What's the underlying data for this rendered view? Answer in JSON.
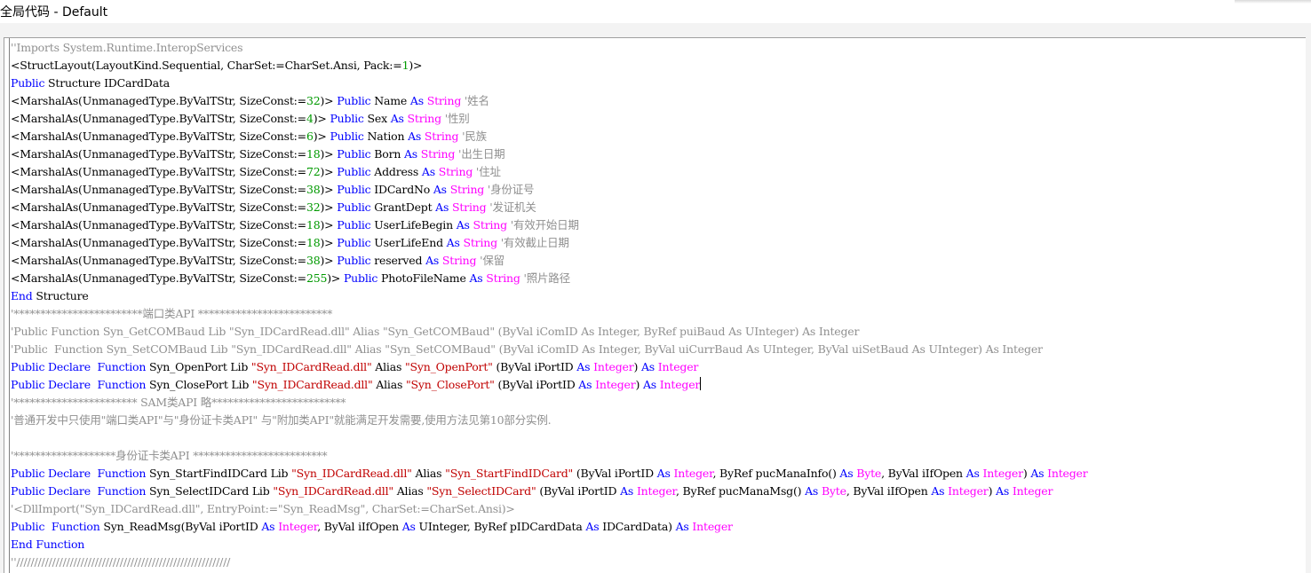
{
  "window": {
    "title": "全局代码 - Default"
  },
  "colors": {
    "keyword": "#0000ff",
    "type": "#ff00ff",
    "string": "#c00000",
    "number": "#009900",
    "comment": "#909090",
    "plain": "#000000"
  },
  "editor": {
    "lines": [
      [
        [
          "c",
          "''Imports System.Runtime.InteropServices"
        ]
      ],
      [
        [
          "p",
          "<StructLayout(LayoutKind.Sequential, CharSet:=CharSet.Ansi, Pack:="
        ],
        [
          "n",
          "1"
        ],
        [
          "p",
          ")>"
        ]
      ],
      [
        [
          "k",
          "Public"
        ],
        [
          "p",
          " Structure IDCardData"
        ]
      ],
      [
        [
          "p",
          "<MarshalAs(UnmanagedType.ByValTStr, SizeConst:="
        ],
        [
          "n",
          "32"
        ],
        [
          "p",
          ")> "
        ],
        [
          "k",
          "Public"
        ],
        [
          "p",
          " Name "
        ],
        [
          "k",
          "As"
        ],
        [
          "p",
          " "
        ],
        [
          "t",
          "String"
        ],
        [
          "p",
          " "
        ],
        [
          "c",
          "'姓名"
        ]
      ],
      [
        [
          "p",
          "<MarshalAs(UnmanagedType.ByValTStr, SizeConst:="
        ],
        [
          "n",
          "4"
        ],
        [
          "p",
          ")> "
        ],
        [
          "k",
          "Public"
        ],
        [
          "p",
          " Sex "
        ],
        [
          "k",
          "As"
        ],
        [
          "p",
          " "
        ],
        [
          "t",
          "String"
        ],
        [
          "p",
          " "
        ],
        [
          "c",
          "'性别"
        ]
      ],
      [
        [
          "p",
          "<MarshalAs(UnmanagedType.ByValTStr, SizeConst:="
        ],
        [
          "n",
          "6"
        ],
        [
          "p",
          ")> "
        ],
        [
          "k",
          "Public"
        ],
        [
          "p",
          " Nation "
        ],
        [
          "k",
          "As"
        ],
        [
          "p",
          " "
        ],
        [
          "t",
          "String"
        ],
        [
          "p",
          " "
        ],
        [
          "c",
          "'民族"
        ]
      ],
      [
        [
          "p",
          "<MarshalAs(UnmanagedType.ByValTStr, SizeConst:="
        ],
        [
          "n",
          "18"
        ],
        [
          "p",
          ")> "
        ],
        [
          "k",
          "Public"
        ],
        [
          "p",
          " Born "
        ],
        [
          "k",
          "As"
        ],
        [
          "p",
          " "
        ],
        [
          "t",
          "String"
        ],
        [
          "p",
          " "
        ],
        [
          "c",
          "'出生日期"
        ]
      ],
      [
        [
          "p",
          "<MarshalAs(UnmanagedType.ByValTStr, SizeConst:="
        ],
        [
          "n",
          "72"
        ],
        [
          "p",
          ")> "
        ],
        [
          "k",
          "Public"
        ],
        [
          "p",
          " Address "
        ],
        [
          "k",
          "As"
        ],
        [
          "p",
          " "
        ],
        [
          "t",
          "String"
        ],
        [
          "p",
          " "
        ],
        [
          "c",
          "'住址"
        ]
      ],
      [
        [
          "p",
          "<MarshalAs(UnmanagedType.ByValTStr, SizeConst:="
        ],
        [
          "n",
          "38"
        ],
        [
          "p",
          ")> "
        ],
        [
          "k",
          "Public"
        ],
        [
          "p",
          " IDCardNo "
        ],
        [
          "k",
          "As"
        ],
        [
          "p",
          " "
        ],
        [
          "t",
          "String"
        ],
        [
          "p",
          " "
        ],
        [
          "c",
          "'身份证号"
        ]
      ],
      [
        [
          "p",
          "<MarshalAs(UnmanagedType.ByValTStr, SizeConst:="
        ],
        [
          "n",
          "32"
        ],
        [
          "p",
          ")> "
        ],
        [
          "k",
          "Public"
        ],
        [
          "p",
          " GrantDept "
        ],
        [
          "k",
          "As"
        ],
        [
          "p",
          " "
        ],
        [
          "t",
          "String"
        ],
        [
          "p",
          " "
        ],
        [
          "c",
          "'发证机关"
        ]
      ],
      [
        [
          "p",
          "<MarshalAs(UnmanagedType.ByValTStr, SizeConst:="
        ],
        [
          "n",
          "18"
        ],
        [
          "p",
          ")> "
        ],
        [
          "k",
          "Public"
        ],
        [
          "p",
          " UserLifeBegin "
        ],
        [
          "k",
          "As"
        ],
        [
          "p",
          " "
        ],
        [
          "t",
          "String"
        ],
        [
          "p",
          " "
        ],
        [
          "c",
          "'有效开始日期"
        ]
      ],
      [
        [
          "p",
          "<MarshalAs(UnmanagedType.ByValTStr, SizeConst:="
        ],
        [
          "n",
          "18"
        ],
        [
          "p",
          ")> "
        ],
        [
          "k",
          "Public"
        ],
        [
          "p",
          " UserLifeEnd "
        ],
        [
          "k",
          "As"
        ],
        [
          "p",
          " "
        ],
        [
          "t",
          "String"
        ],
        [
          "p",
          " "
        ],
        [
          "c",
          "'有效截止日期"
        ]
      ],
      [
        [
          "p",
          "<MarshalAs(UnmanagedType.ByValTStr, SizeConst:="
        ],
        [
          "n",
          "38"
        ],
        [
          "p",
          ")> "
        ],
        [
          "k",
          "Public"
        ],
        [
          "p",
          " reserved "
        ],
        [
          "k",
          "As"
        ],
        [
          "p",
          " "
        ],
        [
          "t",
          "String"
        ],
        [
          "p",
          " "
        ],
        [
          "c",
          "'保留"
        ]
      ],
      [
        [
          "p",
          "<MarshalAs(UnmanagedType.ByValTStr, SizeConst:="
        ],
        [
          "n",
          "255"
        ],
        [
          "p",
          ")> "
        ],
        [
          "k",
          "Public"
        ],
        [
          "p",
          " PhotoFileName "
        ],
        [
          "k",
          "As"
        ],
        [
          "p",
          " "
        ],
        [
          "t",
          "String"
        ],
        [
          "p",
          " "
        ],
        [
          "c",
          "'照片路径"
        ]
      ],
      [
        [
          "k",
          "End"
        ],
        [
          "p",
          " Structure"
        ]
      ],
      [
        [
          "c",
          "'************************端口类API *************************"
        ]
      ],
      [
        [
          "c",
          "'Public Function Syn_GetCOMBaud Lib \"Syn_IDCardRead.dll\" Alias \"Syn_GetCOMBaud\" (ByVal iComID As Integer, ByRef puiBaud As UInteger) As Integer"
        ]
      ],
      [
        [
          "c",
          "'Public  Function Syn_SetCOMBaud Lib \"Syn_IDCardRead.dll\" Alias \"Syn_SetCOMBaud\" (ByVal iComID As Integer, ByVal uiCurrBaud As UInteger, ByVal uiSetBaud As UInteger) As Integer"
        ]
      ],
      [
        [
          "k",
          "Public"
        ],
        [
          "p",
          " "
        ],
        [
          "k",
          "Declare"
        ],
        [
          "p",
          "  "
        ],
        [
          "k",
          "Function"
        ],
        [
          "p",
          " Syn_OpenPort Lib "
        ],
        [
          "s",
          "\"Syn_IDCardRead.dll\""
        ],
        [
          "p",
          " Alias "
        ],
        [
          "s",
          "\"Syn_OpenPort\""
        ],
        [
          "p",
          " (ByVal iPortID "
        ],
        [
          "k",
          "As"
        ],
        [
          "p",
          " "
        ],
        [
          "t",
          "Integer"
        ],
        [
          "p",
          ") "
        ],
        [
          "k",
          "As"
        ],
        [
          "p",
          " "
        ],
        [
          "t",
          "Integer"
        ]
      ],
      [
        [
          "k",
          "Public"
        ],
        [
          "p",
          " "
        ],
        [
          "k",
          "Declare"
        ],
        [
          "p",
          "  "
        ],
        [
          "k",
          "Function"
        ],
        [
          "p",
          " Syn_ClosePort Lib "
        ],
        [
          "s",
          "\"Syn_IDCardRead.dll\""
        ],
        [
          "p",
          " Alias "
        ],
        [
          "s",
          "\"Syn_ClosePort\""
        ],
        [
          "p",
          " (ByVal iPortID "
        ],
        [
          "k",
          "As"
        ],
        [
          "p",
          " "
        ],
        [
          "t",
          "Integer"
        ],
        [
          "p",
          ") "
        ],
        [
          "k",
          "As"
        ],
        [
          "p",
          " "
        ],
        [
          "t",
          "Integer"
        ],
        [
          "caret",
          ""
        ]
      ],
      [
        [
          "c",
          "'*********************** SAM类API 略*************************"
        ]
      ],
      [
        [
          "c",
          "'普通开发中只使用\"端口类API\"与\"身份证卡类API\" 与\"附加类API\"就能满足开发需要,使用方法见第10部分实例."
        ]
      ],
      [],
      [
        [
          "c",
          "'*******************身份证卡类API *************************"
        ]
      ],
      [
        [
          "k",
          "Public"
        ],
        [
          "p",
          " "
        ],
        [
          "k",
          "Declare"
        ],
        [
          "p",
          "  "
        ],
        [
          "k",
          "Function"
        ],
        [
          "p",
          " Syn_StartFindIDCard Lib "
        ],
        [
          "s",
          "\"Syn_IDCardRead.dll\""
        ],
        [
          "p",
          " Alias "
        ],
        [
          "s",
          "\"Syn_StartFindIDCard\""
        ],
        [
          "p",
          " (ByVal iPortID "
        ],
        [
          "k",
          "As"
        ],
        [
          "p",
          " "
        ],
        [
          "t",
          "Integer"
        ],
        [
          "p",
          ", ByRef pucManaInfo() "
        ],
        [
          "k",
          "As"
        ],
        [
          "p",
          " "
        ],
        [
          "t",
          "Byte"
        ],
        [
          "p",
          ", ByVal iIfOpen "
        ],
        [
          "k",
          "As"
        ],
        [
          "p",
          " "
        ],
        [
          "t",
          "Integer"
        ],
        [
          "p",
          ") "
        ],
        [
          "k",
          "As"
        ],
        [
          "p",
          " "
        ],
        [
          "t",
          "Integer"
        ]
      ],
      [
        [
          "k",
          "Public"
        ],
        [
          "p",
          " "
        ],
        [
          "k",
          "Declare"
        ],
        [
          "p",
          "  "
        ],
        [
          "k",
          "Function"
        ],
        [
          "p",
          " Syn_SelectIDCard Lib "
        ],
        [
          "s",
          "\"Syn_IDCardRead.dll\""
        ],
        [
          "p",
          " Alias "
        ],
        [
          "s",
          "\"Syn_SelectIDCard\""
        ],
        [
          "p",
          " (ByVal iPortID "
        ],
        [
          "k",
          "As"
        ],
        [
          "p",
          " "
        ],
        [
          "t",
          "Integer"
        ],
        [
          "p",
          ", ByRef pucManaMsg() "
        ],
        [
          "k",
          "As"
        ],
        [
          "p",
          " "
        ],
        [
          "t",
          "Byte"
        ],
        [
          "p",
          ", ByVal iIfOpen "
        ],
        [
          "k",
          "As"
        ],
        [
          "p",
          " "
        ],
        [
          "t",
          "Integer"
        ],
        [
          "p",
          ") "
        ],
        [
          "k",
          "As"
        ],
        [
          "p",
          " "
        ],
        [
          "t",
          "Integer"
        ]
      ],
      [
        [
          "c",
          "'<DllImport(\"Syn_IDCardRead.dll\", EntryPoint:=\"Syn_ReadMsg\", CharSet:=CharSet.Ansi)>"
        ]
      ],
      [
        [
          "k",
          "Public"
        ],
        [
          "p",
          "  "
        ],
        [
          "k",
          "Function"
        ],
        [
          "p",
          " Syn_ReadMsg(ByVal iPortID "
        ],
        [
          "k",
          "As"
        ],
        [
          "p",
          " "
        ],
        [
          "t",
          "Integer"
        ],
        [
          "p",
          ", ByVal iIfOpen "
        ],
        [
          "k",
          "As"
        ],
        [
          "p",
          " UInteger, ByRef pIDCardData "
        ],
        [
          "k",
          "As"
        ],
        [
          "p",
          " IDCardData) "
        ],
        [
          "k",
          "As"
        ],
        [
          "p",
          " "
        ],
        [
          "t",
          "Integer"
        ]
      ],
      [
        [
          "k",
          "End"
        ],
        [
          "p",
          " "
        ],
        [
          "k",
          "Function"
        ]
      ],
      [
        [
          "c",
          "''////////////////////////////////////////////////////////////"
        ]
      ]
    ]
  }
}
